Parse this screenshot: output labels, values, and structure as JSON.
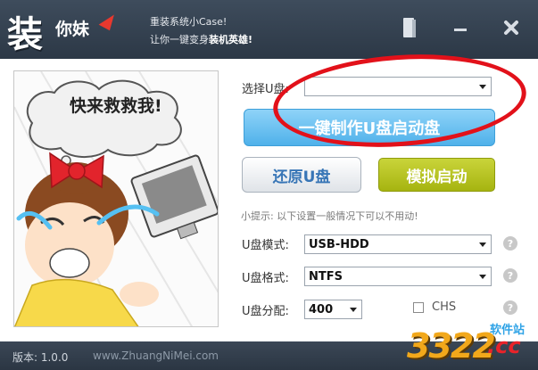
{
  "app": {
    "logo_main": "装",
    "logo_sub": "你妹",
    "slogan_line1": "重装系统小Case!",
    "slogan_line2_prefix": "让你一键变身",
    "slogan_line2_bold": "装机英雄!"
  },
  "art": {
    "bubble_text": "快来救救我!"
  },
  "form": {
    "select_u_label": "选择U盘:",
    "select_u_value": "",
    "make_button": "一键制作U盘启动盘",
    "restore_button": "还原U盘",
    "simulate_button": "模拟启动",
    "tip": "小提示: 以下设置一般情况下可以不用动!",
    "mode_label": "U盘模式:",
    "mode_value": "USB-HDD",
    "format_label": "U盘格式:",
    "format_value": "NTFS",
    "partition_label": "U盘分配:",
    "partition_value": "400",
    "chs_label": "CHS",
    "help_glyph": "?"
  },
  "status": {
    "version": "版本: 1.0.0",
    "website": "www.ZhuangNiMei.com"
  },
  "watermark": {
    "number": "3322",
    "site_label": "软件站",
    "tld": ".cc"
  },
  "colors": {
    "titlebar": "#2c3846",
    "primary_button": "#4fb1ea",
    "simulate_button": "#a6b410",
    "annotation_ring": "#e2111a"
  }
}
